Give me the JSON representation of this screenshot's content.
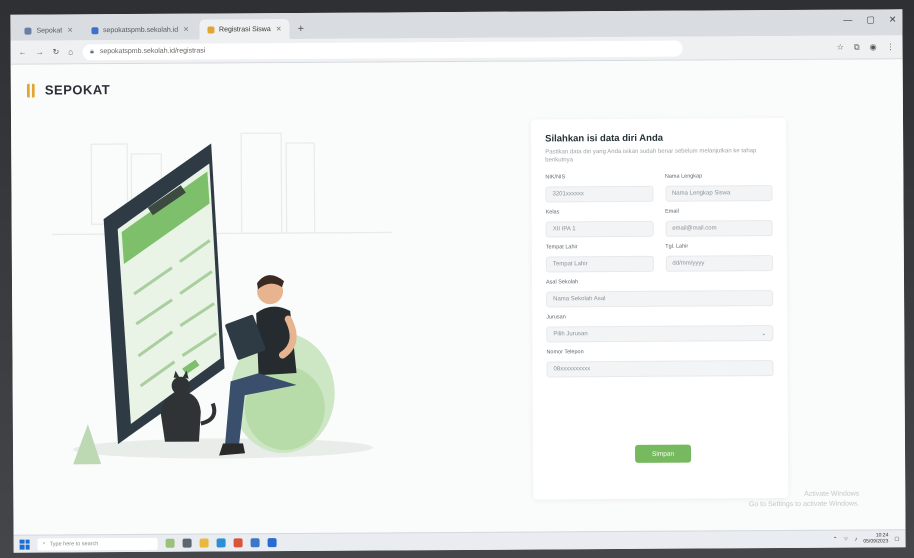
{
  "browser": {
    "tabs": [
      {
        "label": "Sepokat",
        "active": false
      },
      {
        "label": "sepokatspmb.sekolah.id",
        "active": false
      },
      {
        "label": "Registrasi Siswa",
        "active": true
      }
    ],
    "new_tab": "+",
    "url": "sepokatspmb.sekolah.id/registrasi",
    "window_controls": [
      "—",
      "▢",
      "✕"
    ]
  },
  "brand": {
    "name": "SEPOKAT",
    "accent": "#e2a531"
  },
  "form": {
    "title": "Silahkan isi data diri Anda",
    "subtitle": "Pastikan data diri yang Anda isikan sudah benar sebelum melanjutkan ke tahap berikutnya",
    "fields": [
      {
        "label": "NIK/NIS",
        "value": "3201xxxxxx",
        "span": "half"
      },
      {
        "label": "Nama Lengkap",
        "value": "Nama Lengkap Siswa",
        "span": "half"
      },
      {
        "label": "Kelas",
        "value": "XII IPA 1",
        "span": "half"
      },
      {
        "label": "Email",
        "value": "email@mail.com",
        "span": "half"
      },
      {
        "label": "Tempat Lahir",
        "value": "Tempat Lahir",
        "span": "half"
      },
      {
        "label": "Tgl. Lahir",
        "value": "dd/mm/yyyy",
        "span": "half"
      },
      {
        "label": "Asal Sekolah",
        "value": "Nama Sekolah Asal",
        "span": "full"
      },
      {
        "label": "Jurusan",
        "value": "Pilih Jurusan",
        "span": "full",
        "dropdown": true
      },
      {
        "label": "Nomor Telepon",
        "value": "08xxxxxxxxxx",
        "span": "full"
      }
    ],
    "submit_label": "Simpan",
    "accent": "#76b95e"
  },
  "watermark": {
    "line1": "Activate Windows",
    "line2": "Go to Settings to activate Windows."
  },
  "taskbar": {
    "search_placeholder": "Type here to search",
    "time": "10:24",
    "date": "05/09/2023"
  }
}
